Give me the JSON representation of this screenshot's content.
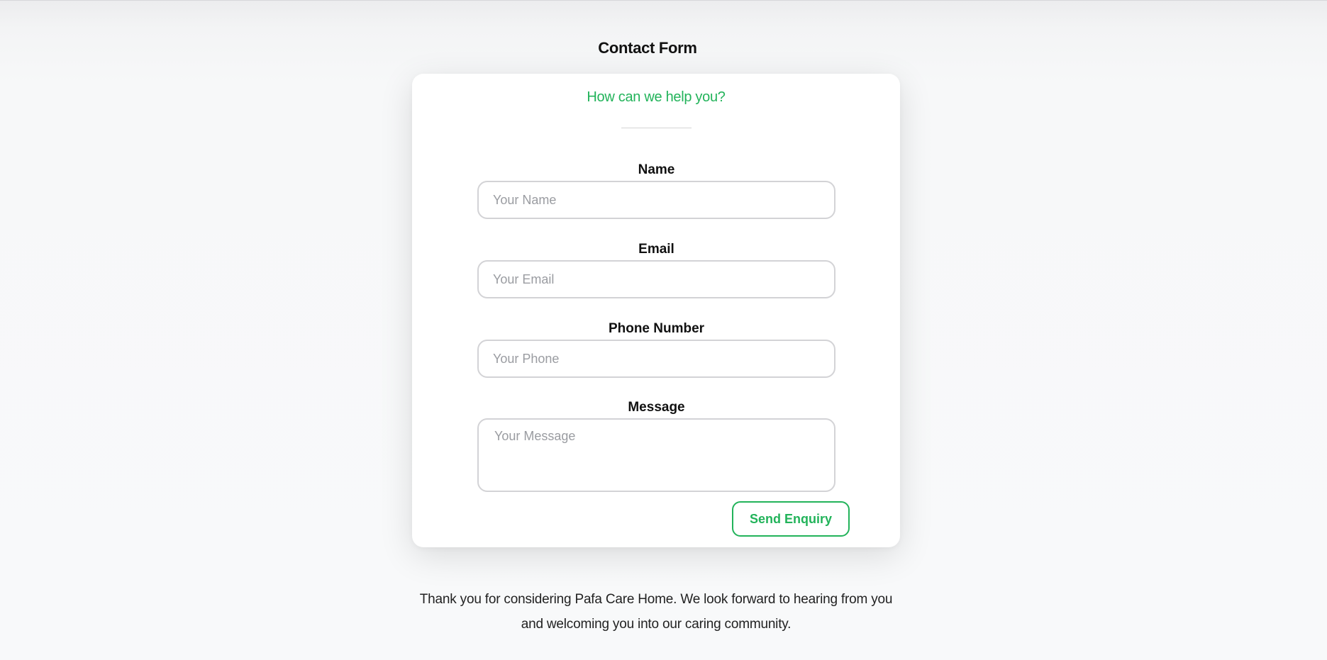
{
  "page": {
    "title": "Contact Form"
  },
  "card": {
    "subtitle": "How can we help you?"
  },
  "form": {
    "name": {
      "label": "Name",
      "placeholder": "Your Name",
      "value": ""
    },
    "email": {
      "label": "Email",
      "placeholder": "Your Email",
      "value": ""
    },
    "phone": {
      "label": "Phone Number",
      "placeholder": "Your Phone",
      "value": ""
    },
    "message": {
      "label": "Message",
      "placeholder": "Your Message",
      "value": ""
    },
    "submit_label": "Send Enquiry"
  },
  "footer": {
    "text": "Thank you for considering Pafa Care Home. We look forward to hearing from you and welcoming you into our caring community."
  },
  "colors": {
    "accent": "#22b35a",
    "background": "#f8f9fa",
    "card": "#ffffff",
    "input_border": "#d3d3d6"
  }
}
